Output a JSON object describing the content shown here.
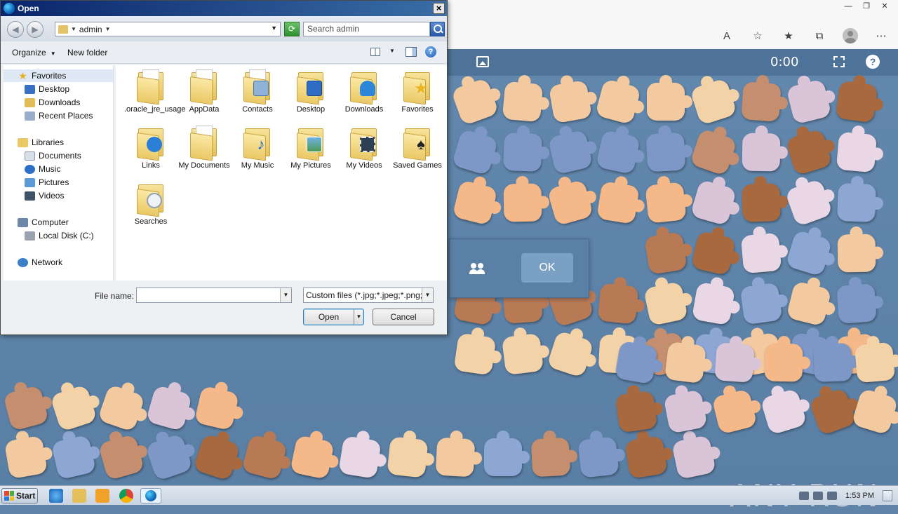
{
  "dialog": {
    "title": "Open",
    "path": "admin",
    "search_placeholder": "Search admin",
    "toolbar": {
      "organize": "Organize",
      "new_folder": "New folder"
    },
    "nav": [
      {
        "label": "Favorites",
        "icon": "star-icon",
        "section": true
      },
      {
        "label": "Desktop",
        "icon": "desktop-icon"
      },
      {
        "label": "Downloads",
        "icon": "downloads-icon"
      },
      {
        "label": "Recent Places",
        "icon": "recent-places-icon"
      },
      {
        "label": "Libraries",
        "icon": "libraries-icon",
        "section": true
      },
      {
        "label": "Documents",
        "icon": "documents-icon"
      },
      {
        "label": "Music",
        "icon": "music-icon"
      },
      {
        "label": "Pictures",
        "icon": "pictures-icon"
      },
      {
        "label": "Videos",
        "icon": "videos-icon"
      },
      {
        "label": "Computer",
        "icon": "computer-icon",
        "section": true
      },
      {
        "label": "Local Disk (C:)",
        "icon": "local-disk-icon"
      },
      {
        "label": "Network",
        "icon": "network-icon",
        "section": true
      }
    ],
    "items": [
      {
        "label": ".oracle_jre_usage",
        "icon": "folder-icon"
      },
      {
        "label": "AppData",
        "icon": "folder-icon"
      },
      {
        "label": "Contacts",
        "icon": "contacts-folder-icon"
      },
      {
        "label": "Desktop",
        "icon": "desktop-folder-icon"
      },
      {
        "label": "Downloads",
        "icon": "downloads-folder-icon"
      },
      {
        "label": "Favorites",
        "icon": "favorites-folder-icon"
      },
      {
        "label": "Links",
        "icon": "links-folder-icon"
      },
      {
        "label": "My Documents",
        "icon": "documents-folder-icon"
      },
      {
        "label": "My Music",
        "icon": "music-folder-icon"
      },
      {
        "label": "My Pictures",
        "icon": "pictures-folder-icon"
      },
      {
        "label": "My Videos",
        "icon": "videos-folder-icon"
      },
      {
        "label": "Saved Games",
        "icon": "saved-games-folder-icon"
      },
      {
        "label": "Searches",
        "icon": "searches-folder-icon"
      }
    ],
    "file_name_label": "File name:",
    "file_name_value": "",
    "file_type": "Custom files (*.jpg;*.jpeg;*.png;",
    "open_label": "Open",
    "cancel_label": "Cancel"
  },
  "browser": {
    "timer": "0:00",
    "modal_ok": "OK"
  },
  "watermark": "ANY RUN",
  "taskbar": {
    "start_label": "Start",
    "clock": "1:53 PM"
  }
}
